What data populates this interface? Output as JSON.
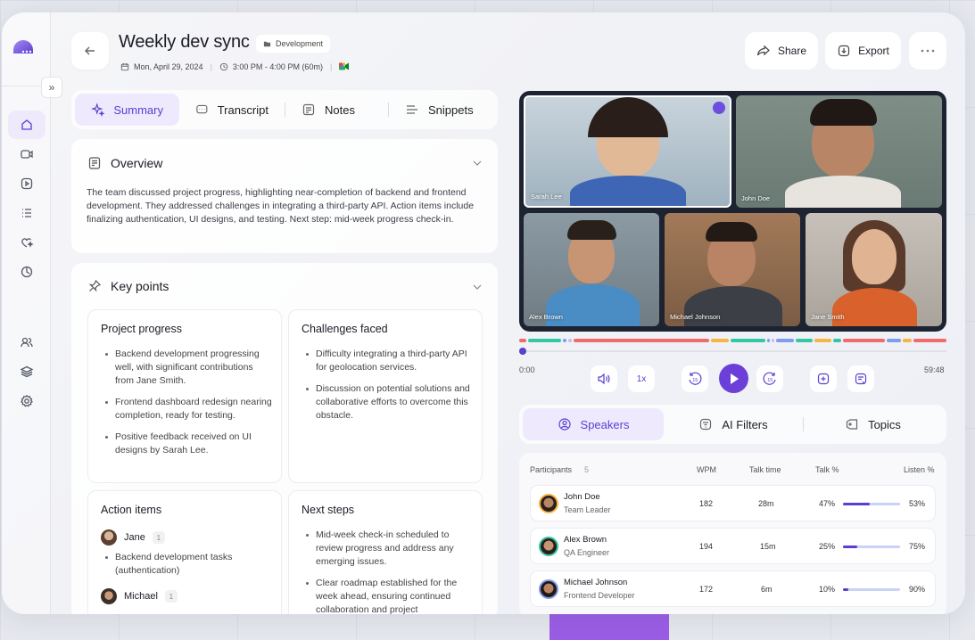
{
  "header": {
    "title": "Weekly dev sync",
    "tag": "Development",
    "date": "Mon, April 29, 2024",
    "time": "3:00 PM - 4:00 PM (60m)",
    "share_label": "Share",
    "export_label": "Export"
  },
  "tabs": [
    {
      "label": "Summary",
      "icon": "sparkle-icon",
      "active": true
    },
    {
      "label": "Transcript",
      "icon": "chat-icon",
      "active": false
    },
    {
      "label": "Notes",
      "icon": "note-icon",
      "active": false
    },
    {
      "label": "Snippets",
      "icon": "list-icon",
      "active": false
    }
  ],
  "overview": {
    "heading": "Overview",
    "text": "The team discussed project progress, highlighting near-completion of backend and frontend development. They addressed challenges in integrating a third-party API. Action items include finalizing authentication, UI designs, and testing. Next step: mid-week progress check-in."
  },
  "key_points": {
    "heading": "Key points",
    "project_progress": {
      "title": "Project progress",
      "items": [
        "Backend development progressing well, with significant contributions from Jane Smith.",
        "Frontend dashboard redesign nearing completion, ready for testing.",
        "Positive feedback received on UI designs by Sarah Lee."
      ]
    },
    "challenges": {
      "title": "Challenges faced",
      "items": [
        "Difficulty integrating a third-party API for geolocation services.",
        "Discussion on potential solutions and collaborative efforts to overcome this obstacle."
      ]
    },
    "action_items": {
      "title": "Action items",
      "people": [
        {
          "name": "Jane",
          "count": "1",
          "items": [
            "Backend development tasks (authentication)"
          ]
        },
        {
          "name": "Michael",
          "count": "1",
          "items": []
        }
      ]
    },
    "next_steps": {
      "title": "Next steps",
      "items": [
        "Mid-week check-in scheduled to review progress and address any emerging issues.",
        "Clear roadmap established for the week ahead, ensuring continued collaboration and project"
      ]
    }
  },
  "video": {
    "tiles": [
      {
        "name": "Sarah Lee",
        "speaking": true
      },
      {
        "name": "John Doe"
      },
      {
        "name": "Alex Brown"
      },
      {
        "name": "Michael Johnson"
      },
      {
        "name": "Jane Smith"
      }
    ]
  },
  "player": {
    "current": "0:00",
    "total": "59:48",
    "speed": "1x",
    "progress": 0.0
  },
  "right_tabs": [
    {
      "label": "Speakers",
      "active": true
    },
    {
      "label": "AI Filters",
      "active": false
    },
    {
      "label": "Topics",
      "active": false
    }
  ],
  "participants": {
    "label": "Participants",
    "count": "5",
    "columns": [
      "WPM",
      "Talk time",
      "Talk %",
      "Listen %"
    ],
    "rows": [
      {
        "name": "John Doe",
        "role": "Team Leader",
        "wpm": "182",
        "talk_time": "28m",
        "talk_pct": "47%",
        "talk_frac": 0.47,
        "listen_pct": "53%"
      },
      {
        "name": "Alex Brown",
        "role": "QA Engineer",
        "wpm": "194",
        "talk_time": "15m",
        "talk_pct": "25%",
        "talk_frac": 0.25,
        "listen_pct": "75%"
      },
      {
        "name": "Michael Johnson",
        "role": "Frontend Developer",
        "wpm": "172",
        "talk_time": "6m",
        "talk_pct": "10%",
        "talk_frac": 0.1,
        "listen_pct": "90%"
      }
    ]
  },
  "colors": {
    "accent": "#5a3fd0",
    "accent_soft": "#efe9fd"
  }
}
